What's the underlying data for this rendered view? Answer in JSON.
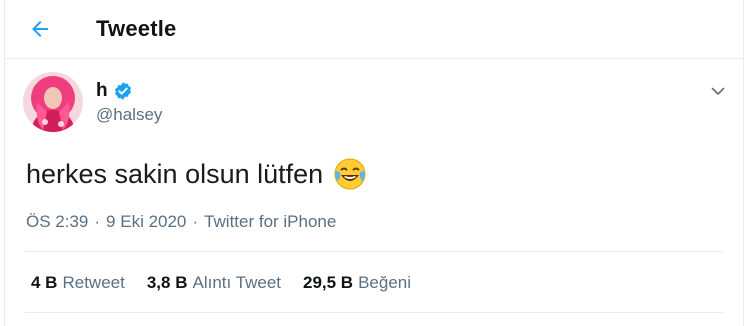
{
  "header": {
    "title": "Tweetle",
    "back_icon": "arrow-left-icon",
    "accent_color": "#1da1f2"
  },
  "tweet": {
    "author": {
      "display_name": "h",
      "handle": "@halsey",
      "verified_icon": "verified-badge-icon"
    },
    "text": "herkes sakin olsun lütfen",
    "emoji": "😂",
    "time": "ÖS 2:39",
    "date": "9 Eki 2020",
    "source": "Twitter for iPhone",
    "separator": "·"
  },
  "stats": {
    "retweets": {
      "count": "4 B",
      "label": "Retweet"
    },
    "quotes": {
      "count": "3,8 B",
      "label": "Alıntı Tweet"
    },
    "likes": {
      "count": "29,5 B",
      "label": "Beğeni"
    }
  }
}
